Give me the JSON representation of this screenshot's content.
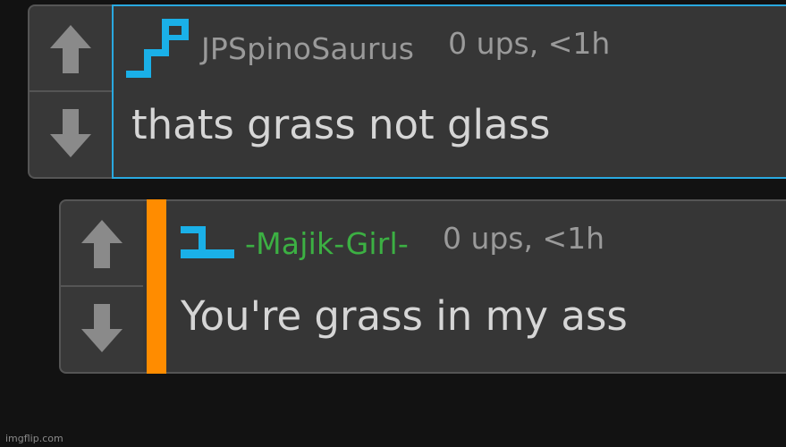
{
  "comments": [
    {
      "username": "JPSpinoSaurus",
      "meta": "0 ups, <1h",
      "text": "thats grass not glass",
      "avatar_icon": "pixel-avatar-icon",
      "highlight_color": "#29a9e0"
    },
    {
      "username": "-Majik-Girl-",
      "meta": "0 ups, <1h",
      "text": "You're grass in my ass",
      "avatar_icon": "pixel-avatar-icon",
      "username_color": "#3cb043",
      "reply_bar_color": "#ff8c00"
    }
  ],
  "vote_icons": {
    "up": "up-arrow-icon",
    "down": "down-arrow-icon"
  },
  "watermark": "imgflip.com"
}
